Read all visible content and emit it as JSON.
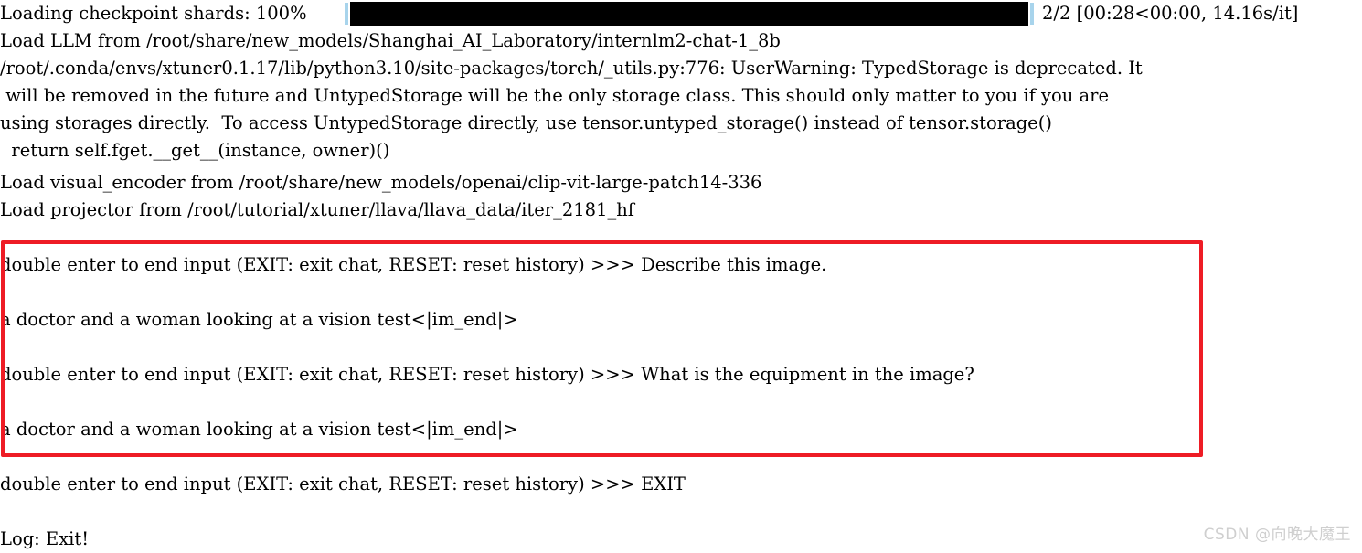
{
  "window": {
    "kind": "terminal-console",
    "background": "#ffffff",
    "foreground": "#000000"
  },
  "progress": {
    "label": "Loading checkpoint shards: 100%",
    "percent": 100,
    "bar_fill_color": "#000000",
    "bar_edge_color": "#a8d4ec",
    "separator": "|",
    "stats": "2/2 [00:28<00:00, 14.16s/it]",
    "current": 2,
    "total": 2,
    "elapsed": "00:28",
    "remaining": "00:00",
    "rate": "14.16s/it"
  },
  "log_lines": [
    "Load LLM from /root/share/new_models/Shanghai_AI_Laboratory/internlm2-chat-1_8b",
    "/root/.conda/envs/xtuner0.1.17/lib/python3.10/site-packages/torch/_utils.py:776: UserWarning: TypedStorage is deprecated. It",
    " will be removed in the future and UntypedStorage will be the only storage class. This should only matter to you if you are",
    "using storages directly.  To access UntypedStorage directly, use tensor.untyped_storage() instead of tensor.storage()",
    "  return self.fget.__get__(instance, owner)()",
    "Load visual_encoder from /root/share/new_models/openai/clip-vit-large-patch14-336",
    "Load projector from /root/tutorial/xtuner/llava/llava_data/iter_2181_hf"
  ],
  "highlight_box": {
    "color": "#ee1c25",
    "border_width_px": 4,
    "lines": [
      "double enter to end input (EXIT: exit chat, RESET: reset history) >>> Describe this image.",
      "",
      "a doctor and a woman looking at a vision test<|im_end|>",
      "",
      "double enter to end input (EXIT: exit chat, RESET: reset history) >>> What is the equipment in the image?",
      "",
      "a doctor and a woman looking at a vision test<|im_end|>"
    ]
  },
  "trailing_lines": [
    "double enter to end input (EXIT: exit chat, RESET: reset history) >>> EXIT",
    "",
    "Log: Exit!"
  ],
  "watermark": {
    "text": "CSDN @向晚大魔王",
    "color": "#cfcfcf"
  }
}
